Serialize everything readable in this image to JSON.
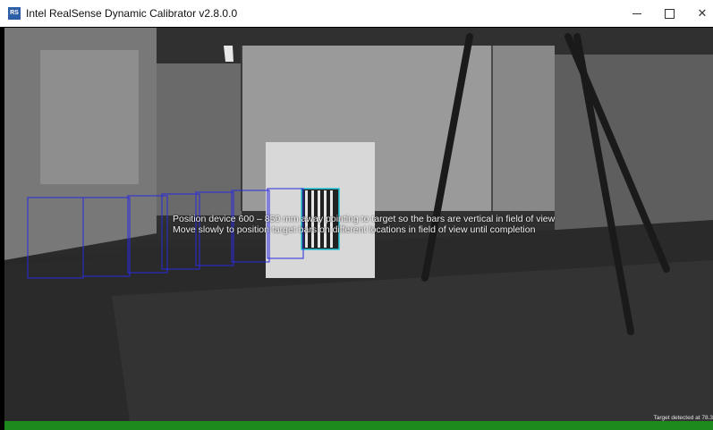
{
  "window": {
    "title": "Intel RealSense Dynamic Calibrator v2.8.0.0",
    "app_icon_text": "RS",
    "controls": [
      "minimize-icon",
      "maximize-icon",
      "close-icon"
    ],
    "close_glyph": "✕"
  },
  "instructions": {
    "line1": "Position device 600 – 850 mm away pointing to target so the bars are vertical in field of view",
    "line2": "Move slowly to position target bars on different locations in field of view until completion"
  },
  "status": {
    "bar_color": "#1c8a1c",
    "progress_text": "",
    "target_detected": "Target detected at 78.3"
  },
  "colors": {
    "title_bg": "#ffffff",
    "overlay_frames": "#2a2ae0",
    "target_outline": "#26c6da"
  }
}
